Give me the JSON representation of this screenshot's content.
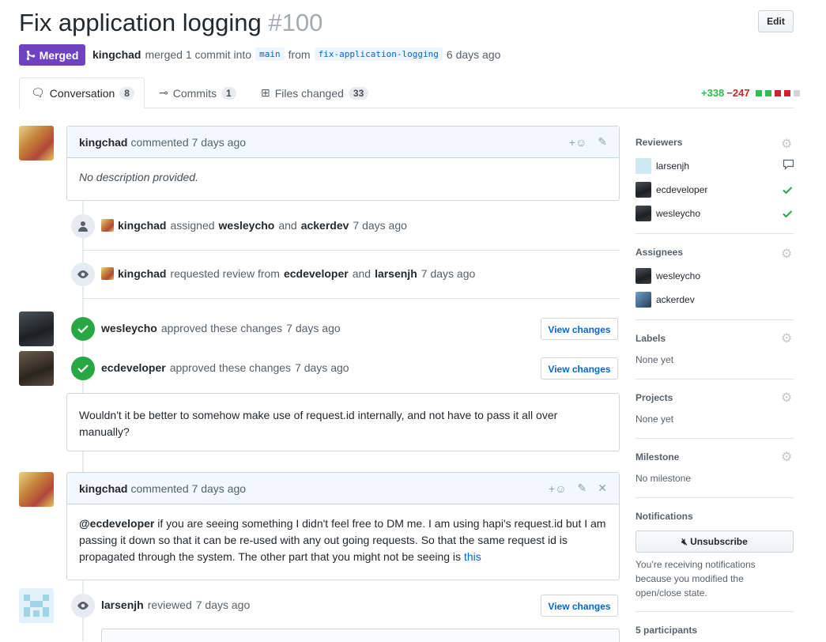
{
  "pr": {
    "title": "Fix application logging",
    "number": "#100",
    "edit_label": "Edit",
    "state_label": "Merged",
    "author": "kingchad",
    "merged_text": "merged 1 commit into",
    "base_branch": "main",
    "from_text": "from",
    "head_branch": "fix-application-logging",
    "time_ago": "6 days ago"
  },
  "tabs": [
    {
      "label": "Conversation",
      "count": "8"
    },
    {
      "label": "Commits",
      "count": "1"
    },
    {
      "label": "Files changed",
      "count": "33"
    }
  ],
  "diffstat": {
    "additions": "+338",
    "deletions": "−247"
  },
  "timeline": {
    "c1": {
      "author": "kingchad",
      "action": "commented",
      "time": "7 days ago",
      "body": "No description provided.",
      "react": "+☺",
      "edit": "✎"
    },
    "e1": {
      "actor": "kingchad",
      "verb": "assigned",
      "user1": "wesleycho",
      "and": "and",
      "user2": "ackerdev",
      "time": "7 days ago"
    },
    "e2": {
      "actor": "kingchad",
      "verb": "requested review from",
      "user1": "ecdeveloper",
      "and": "and",
      "user2": "larsenjh",
      "time": "7 days ago"
    },
    "r1": {
      "author": "wesleycho",
      "verb": "approved these changes",
      "time": "7 days ago",
      "button": "View changes"
    },
    "r2": {
      "author": "ecdeveloper",
      "verb": "approved these changes",
      "time": "7 days ago",
      "button": "View changes",
      "body": "Wouldn't it be better to somehow make use of request.id internally, and not have to pass it all over manually?"
    },
    "c2": {
      "author": "kingchad",
      "action": "commented",
      "time": "7 days ago",
      "react": "+☺",
      "edit": "✎",
      "close": "✕",
      "mention": "@ecdeveloper",
      "body": " if you are seeing something I didn't feel free to DM me. I am using hapi's request.id but I am passing it down so that it can be re-used with any out going requests. So that the same request id is propagated through the system. The other part that you might not be seeing is ",
      "link": "this"
    },
    "r3": {
      "author": "larsenjh",
      "verb": "reviewed",
      "time": "7 days ago",
      "button": "View changes"
    }
  },
  "sidebar": {
    "reviewers": {
      "heading": "Reviewers",
      "items": [
        "larsenjh",
        "ecdeveloper",
        "wesleycho"
      ]
    },
    "assignees": {
      "heading": "Assignees",
      "items": [
        "wesleycho",
        "ackerdev"
      ]
    },
    "labels": {
      "heading": "Labels",
      "value": "None yet"
    },
    "projects": {
      "heading": "Projects",
      "value": "None yet"
    },
    "milestone": {
      "heading": "Milestone",
      "value": "No milestone"
    },
    "notifications": {
      "heading": "Notifications",
      "button": "Unsubscribe",
      "note": "You’re receiving notifications because you modified the open/close state."
    },
    "participants": "5 participants"
  },
  "colors": {
    "merged": "#6f42c1",
    "approve": "#28a745",
    "link": "#0366d6",
    "add": "#2cbe4e",
    "del": "#cb2431"
  }
}
